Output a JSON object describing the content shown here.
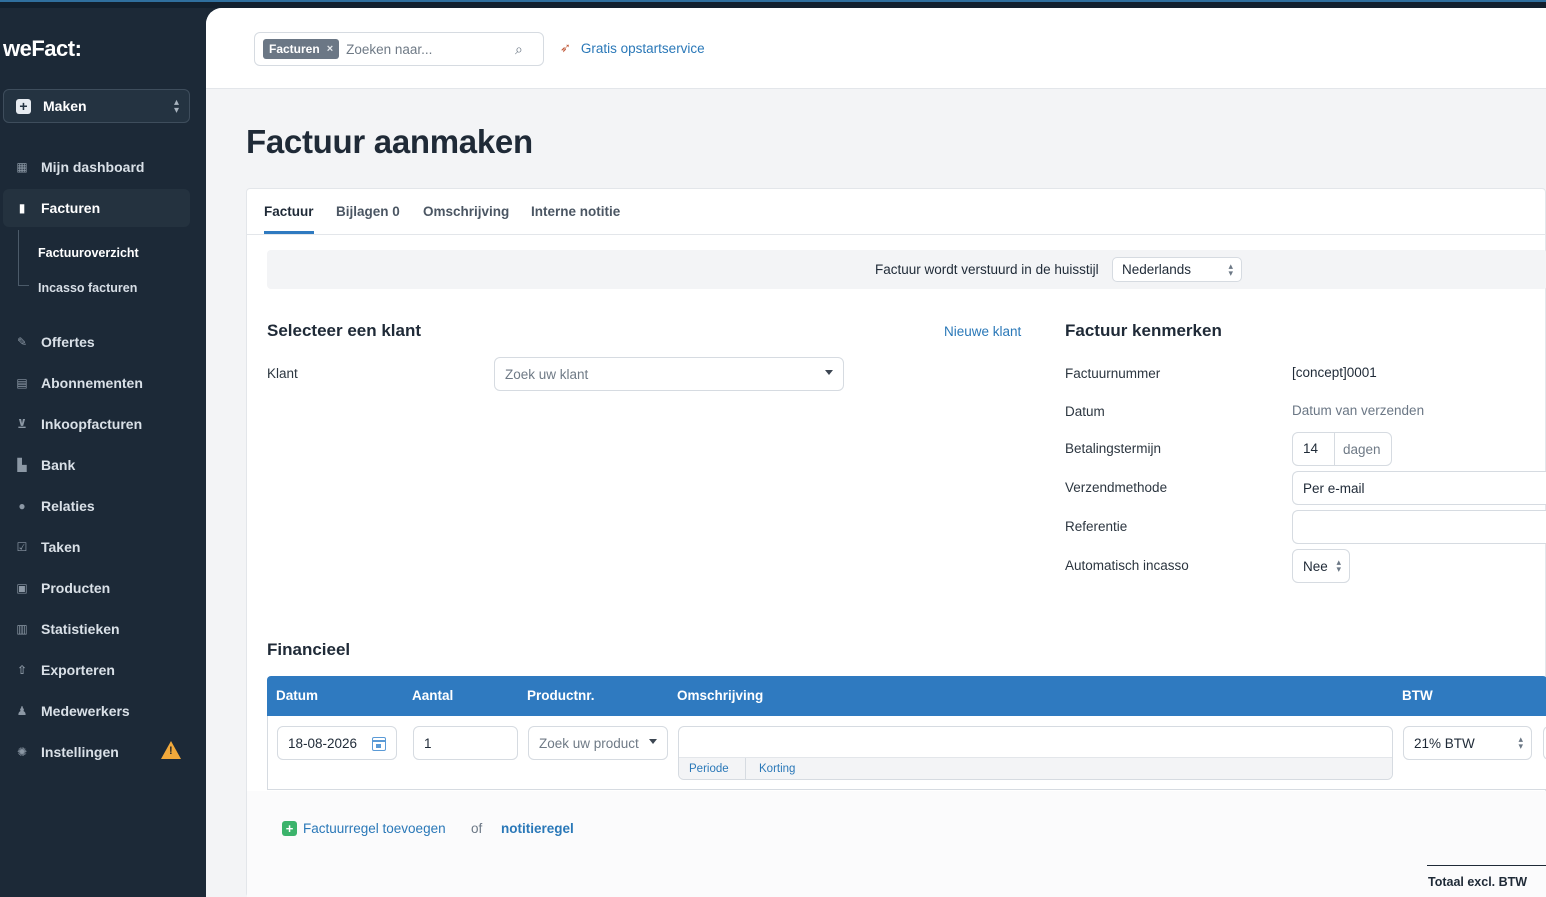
{
  "app": {
    "logo": "weFact:"
  },
  "sidebar": {
    "create_label": "Maken",
    "items": [
      {
        "label": "Mijn dashboard",
        "icon": "grid-icon"
      },
      {
        "label": "Facturen",
        "icon": "document-icon",
        "active": true
      },
      {
        "label": "Offertes",
        "icon": "signature-icon"
      },
      {
        "label": "Abonnementen",
        "icon": "calendar-icon"
      },
      {
        "label": "Inkoopfacturen",
        "icon": "cart-icon"
      },
      {
        "label": "Bank",
        "icon": "bank-icon"
      },
      {
        "label": "Relaties",
        "icon": "users-icon"
      },
      {
        "label": "Taken",
        "icon": "checkbox-icon"
      },
      {
        "label": "Producten",
        "icon": "box-icon"
      },
      {
        "label": "Statistieken",
        "icon": "chart-icon"
      },
      {
        "label": "Exporteren",
        "icon": "upload-icon"
      },
      {
        "label": "Medewerkers",
        "icon": "person-icon"
      },
      {
        "label": "Instellingen",
        "icon": "gear-icon",
        "warning": true
      }
    ],
    "subitems": [
      {
        "label": "Factuuroverzicht",
        "selected": true
      },
      {
        "label": "Incasso facturen"
      }
    ]
  },
  "header": {
    "search_chip": "Facturen",
    "search_chip_close": "×",
    "search_placeholder": "Zoeken naar...",
    "promo_link": "Gratis opstartservice"
  },
  "page": {
    "title": "Factuur aanmaken"
  },
  "tabs": [
    "Factuur",
    "Bijlagen 0",
    "Omschrijving",
    "Interne notitie"
  ],
  "banner": {
    "text": "Factuur wordt verstuurd in de huisstijl",
    "language": "Nederlands"
  },
  "client": {
    "title": "Selecteer een klant",
    "new_link": "Nieuwe klant",
    "label": "Klant",
    "placeholder": "Zoek uw klant"
  },
  "invoice": {
    "title": "Factuur kenmerken",
    "rows": [
      {
        "label": "Factuurnummer",
        "value": "[concept]0001"
      },
      {
        "label": "Datum",
        "value": "Datum van verzenden"
      },
      {
        "label": "Betalingstermijn",
        "value": "14",
        "unit": "dagen"
      },
      {
        "label": "Verzendmethode",
        "value": "Per e-mail"
      },
      {
        "label": "Referentie",
        "value": ""
      },
      {
        "label": "Automatisch incasso",
        "value": "Nee"
      }
    ]
  },
  "financial": {
    "title": "Financieel",
    "columns": [
      "Datum",
      "Aantal",
      "Productnr.",
      "Omschrijving",
      "BTW"
    ],
    "row": {
      "date": "18-08-2026",
      "quantity": "1",
      "product_placeholder": "Zoek uw product",
      "vat": "21% BTW",
      "desc_links": [
        "Periode",
        "Korting"
      ]
    },
    "add_line": "Factuurregel toevoegen",
    "or": "of",
    "note_line": "notitieregel",
    "total_label": "Totaal excl. BTW"
  },
  "colors": {
    "accent": "#2f7ac0",
    "sidebar": "#1c2937",
    "warning": "#f2a93b",
    "add": "#3bb36b"
  }
}
